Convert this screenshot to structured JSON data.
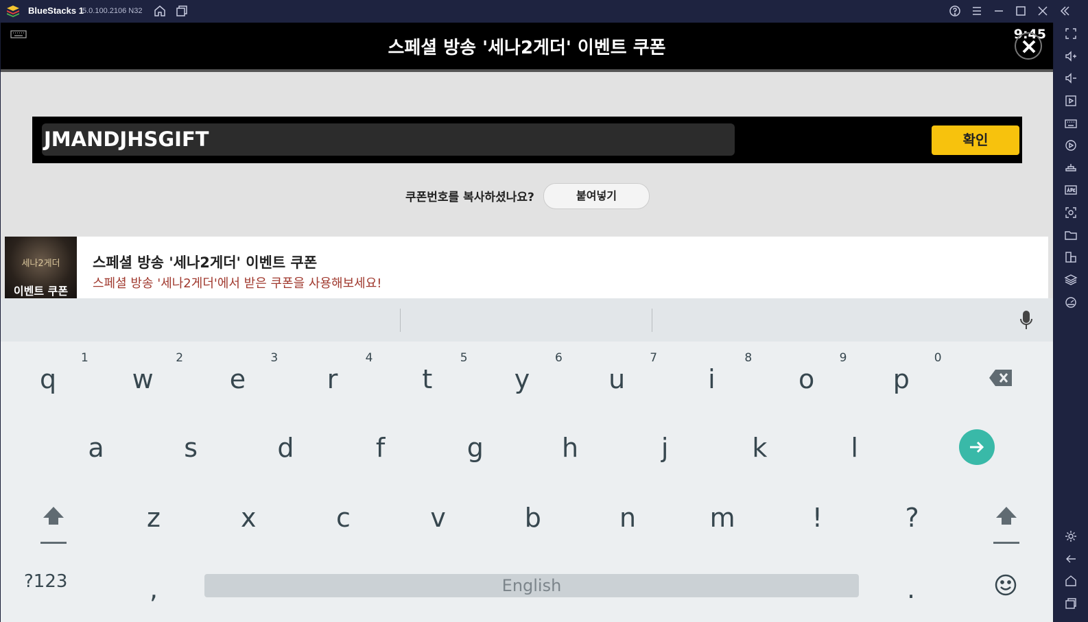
{
  "window": {
    "app_name": "BlueStacks 1",
    "version": "5.0.100.2106 N32"
  },
  "appbar": {
    "title": "스페셜 방송 '세나2게더' 이벤트 쿠폰",
    "clock": "9:45"
  },
  "coupon": {
    "code": "JMANDJHSGIFT",
    "confirm_label": "확인"
  },
  "paste": {
    "question": "쿠폰번호를 복사하셨나요?",
    "button_label": "붙여넣기"
  },
  "event": {
    "thumb_top": "세나2게더",
    "thumb_bottom": "이벤트 쿠폰",
    "title": "스페셜 방송 '세나2게더' 이벤트 쿠폰",
    "subtitle": "스페셜 방송 '세나2게더'에서 받은 쿠폰을 사용해보세요!"
  },
  "keyboard": {
    "row1": [
      {
        "key": "q",
        "hint": "1"
      },
      {
        "key": "w",
        "hint": "2"
      },
      {
        "key": "e",
        "hint": "3"
      },
      {
        "key": "r",
        "hint": "4"
      },
      {
        "key": "t",
        "hint": "5"
      },
      {
        "key": "y",
        "hint": "6"
      },
      {
        "key": "u",
        "hint": "7"
      },
      {
        "key": "i",
        "hint": "8"
      },
      {
        "key": "o",
        "hint": "9"
      },
      {
        "key": "p",
        "hint": "0"
      }
    ],
    "row2": [
      "a",
      "s",
      "d",
      "f",
      "g",
      "h",
      "j",
      "k",
      "l"
    ],
    "row3": [
      "z",
      "x",
      "c",
      "v",
      "b",
      "n",
      "m",
      "!",
      "?"
    ],
    "symbols_label": "?123",
    "comma": ",",
    "space_label": "English",
    "period": "."
  },
  "icons": {
    "titlebar": [
      "home-icon",
      "multi-instance-icon",
      "help-icon",
      "menu-icon",
      "minimize-icon",
      "maximize-icon",
      "close-icon",
      "collapse-icon"
    ],
    "sidebar": [
      "fullscreen-icon",
      "volume-up-icon",
      "volume-down-icon",
      "media-icon",
      "keyboard-controls-icon",
      "macro-icon",
      "game-controls-icon",
      "apk-install-icon",
      "screenshot-icon",
      "folder-icon",
      "multi-instance-icon",
      "layers-icon",
      "performance-icon",
      "settings-icon",
      "back-icon",
      "home-icon",
      "recent-apps-icon"
    ]
  },
  "colors": {
    "accent_yellow": "#f7c20d",
    "enter_teal": "#39b9a8",
    "subtitle_red": "#a0392e",
    "chrome": "#1e2340"
  }
}
